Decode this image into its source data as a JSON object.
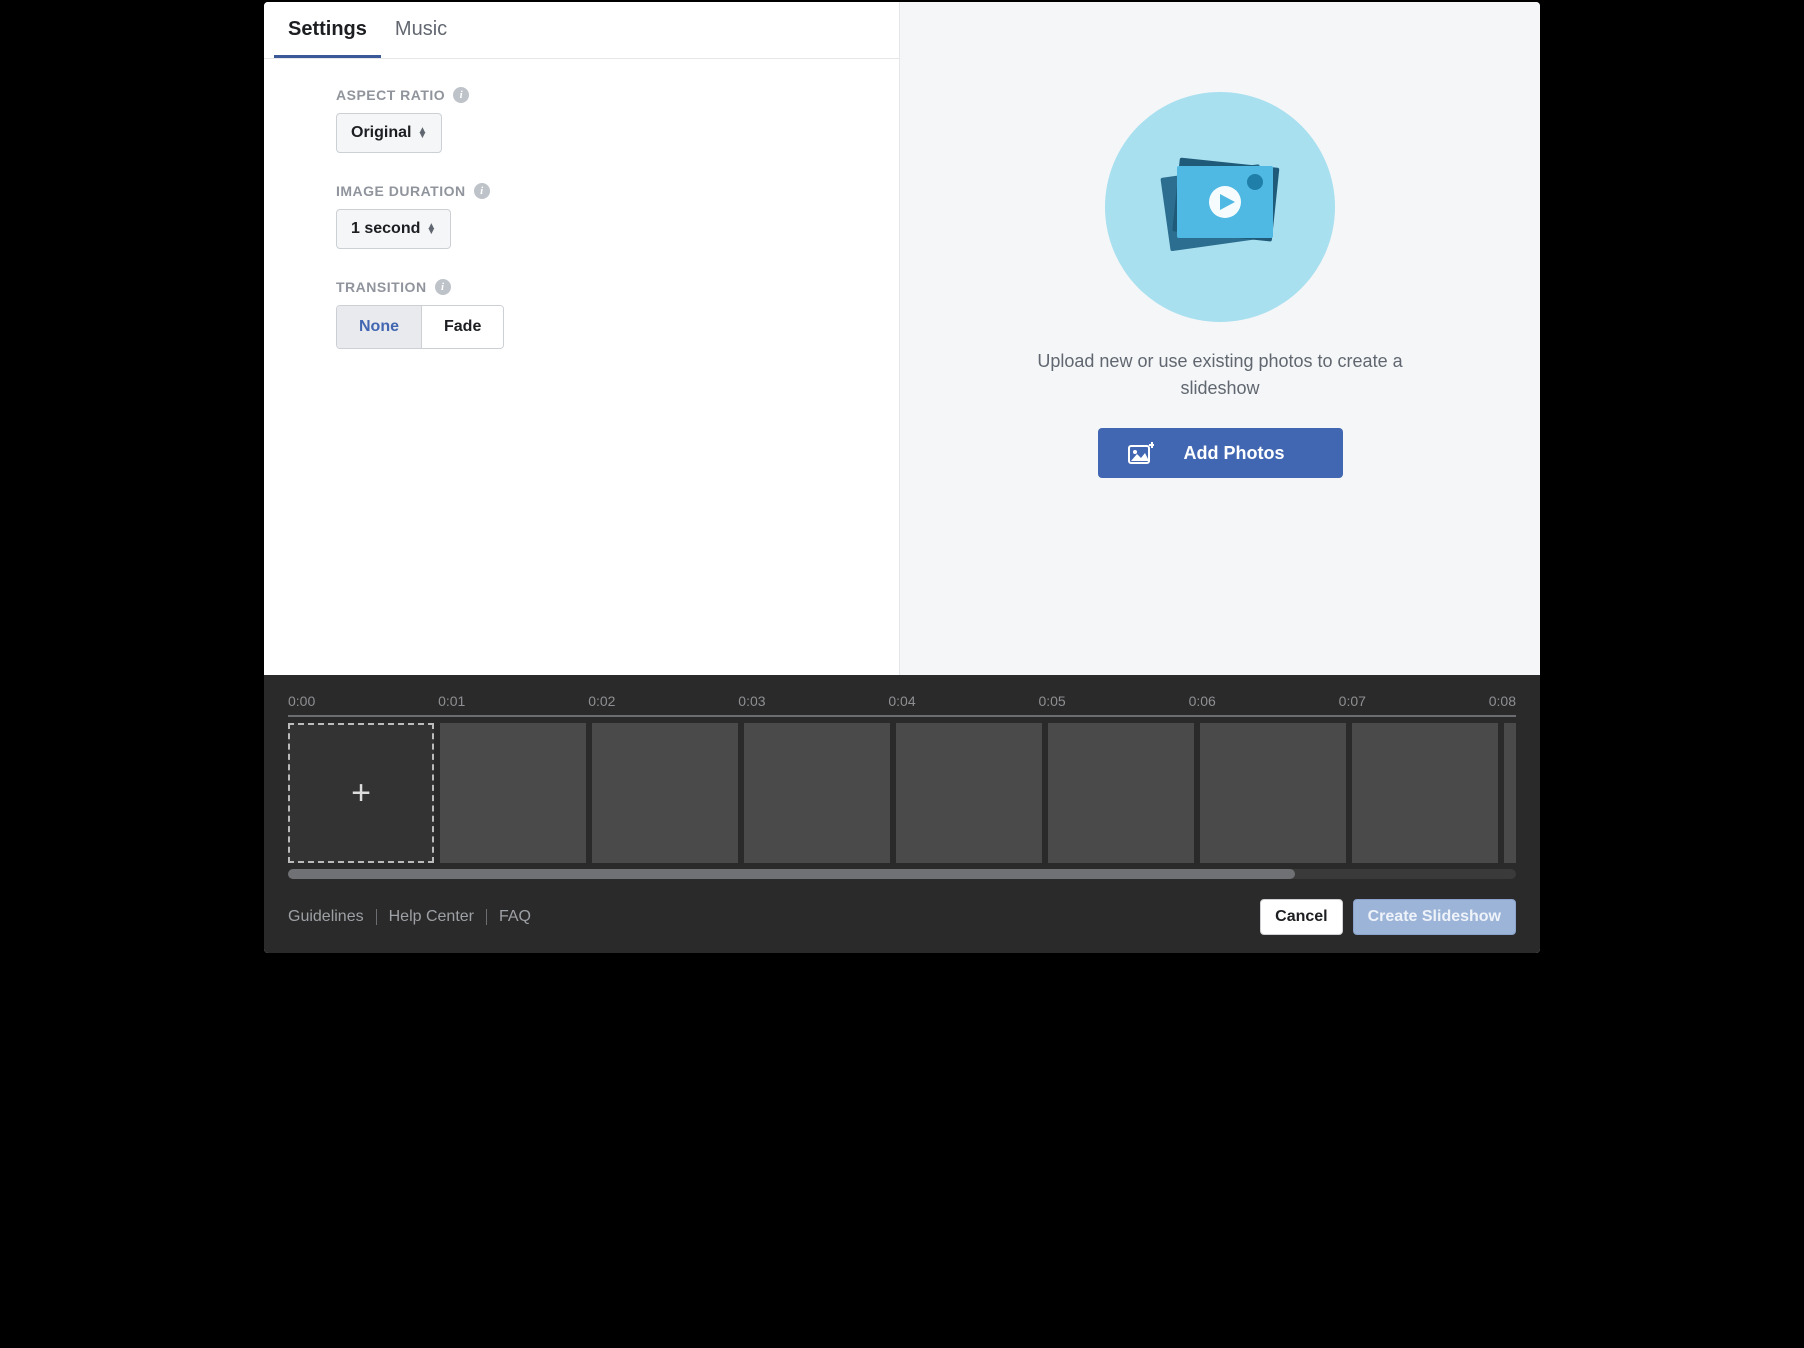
{
  "tabs": {
    "settings": "Settings",
    "music": "Music"
  },
  "settings": {
    "aspect_ratio": {
      "label": "ASPECT RATIO",
      "value": "Original"
    },
    "image_duration": {
      "label": "IMAGE DURATION",
      "value": "1 second"
    },
    "transition": {
      "label": "TRANSITION",
      "none": "None",
      "fade": "Fade"
    }
  },
  "upload": {
    "hint": "Upload new or use existing photos to create a slideshow",
    "button": "Add Photos"
  },
  "timeline": {
    "ticks": [
      "0:00",
      "0:01",
      "0:02",
      "0:03",
      "0:04",
      "0:05",
      "0:06",
      "0:07",
      "0:08"
    ],
    "add_label": "+"
  },
  "footer": {
    "links": {
      "guidelines": "Guidelines",
      "help_center": "Help Center",
      "faq": "FAQ"
    },
    "cancel": "Cancel",
    "create": "Create Slideshow"
  }
}
